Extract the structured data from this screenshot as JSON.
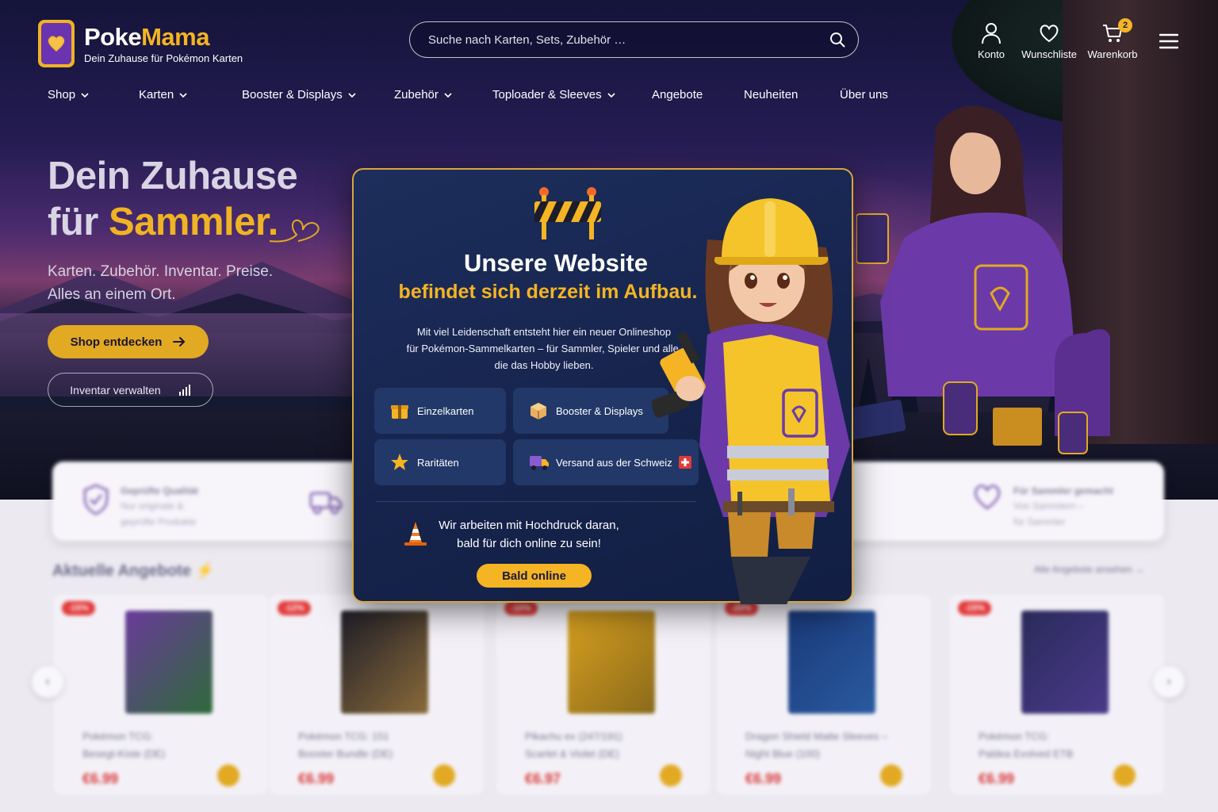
{
  "brand": {
    "name_part1": "Poke",
    "name_part2": "Mama",
    "tagline": "Dein Zuhause für Pokémon Karten"
  },
  "search": {
    "placeholder": "Suche nach Karten, Sets, Zubehör …"
  },
  "header_icons": {
    "account": "Konto",
    "wishlist": "Wunschliste",
    "cart": "Warenkorb",
    "cart_count": "2"
  },
  "nav": [
    "Shop",
    "Karten",
    "Booster & Displays",
    "Zubehör",
    "Toploader & Sleeves",
    "Angebote",
    "Neuheiten",
    "Über uns"
  ],
  "hero": {
    "heading_line1": "Dein Zuhause",
    "heading_line2_prefix": "für ",
    "heading_line2_highlight": "Sammler.",
    "subtitle_line1": "Karten. Zubehör. Inventar. Preise.",
    "subtitle_line2": "Alles an einem Ort.",
    "primary_button": "Shop entdecken",
    "secondary_button": "Inventar verwalten"
  },
  "features": [
    {
      "title": "Geprüfte Qualität",
      "desc_line1": "Nur originale &",
      "desc_line2": "geprüfte Produkte"
    },
    {
      "title": "Für Sammler gemacht",
      "desc_line1": "Von Sammlern –",
      "desc_line2": "für Sammler"
    }
  ],
  "offers": {
    "title": "Aktuelle Angebote",
    "link": "Alle Angebote ansehen",
    "products": [
      {
        "badge": "-15%",
        "name_line1": "Pokémon TCG:",
        "name_line2": "Besegt-Kiste (DE)",
        "price": "€6.99"
      },
      {
        "badge": "-12%",
        "name_line1": "Pokémon TCG: 151",
        "name_line2": "Booster Bundle (DE)",
        "price": "€6.99"
      },
      {
        "badge": "-10%",
        "name_line1": "Pikachu ex (247/191)",
        "name_line2": "Scarlet & Violet (DE)",
        "price": "€6.97"
      },
      {
        "badge": "-20%",
        "name_line1": "Dragon Shield Matte Sleeves –",
        "name_line2": "Night Blue (100)",
        "price": "€6.99"
      },
      {
        "badge": "-15%",
        "name_line1": "Pokémon TCG:",
        "name_line2": "Paldea Evolved ETB",
        "price": "€6.99"
      }
    ]
  },
  "modal": {
    "title": "Unsere Website",
    "subtitle": "befindet sich derzeit im Aufbau.",
    "desc_line1": "Mit viel Leidenschaft entsteht hier ein neuer Onlineshop",
    "desc_line2": "für Pokémon-Sammelkarten – für Sammler, Spieler und alle,",
    "desc_line3": "die das Hobby lieben.",
    "tiles": [
      "Einzelkarten",
      "Booster & Displays",
      "Raritäten",
      "Versand aus der Schweiz"
    ],
    "working_line1": "Wir arbeiten mit Hochdruck daran,",
    "working_line2": "bald für dich online zu sein!",
    "button": "Bald online"
  },
  "colors": {
    "gold": "#f4b424",
    "purple": "#6a34b0",
    "navy": "#16244d",
    "sale_red": "#e23a3a"
  }
}
